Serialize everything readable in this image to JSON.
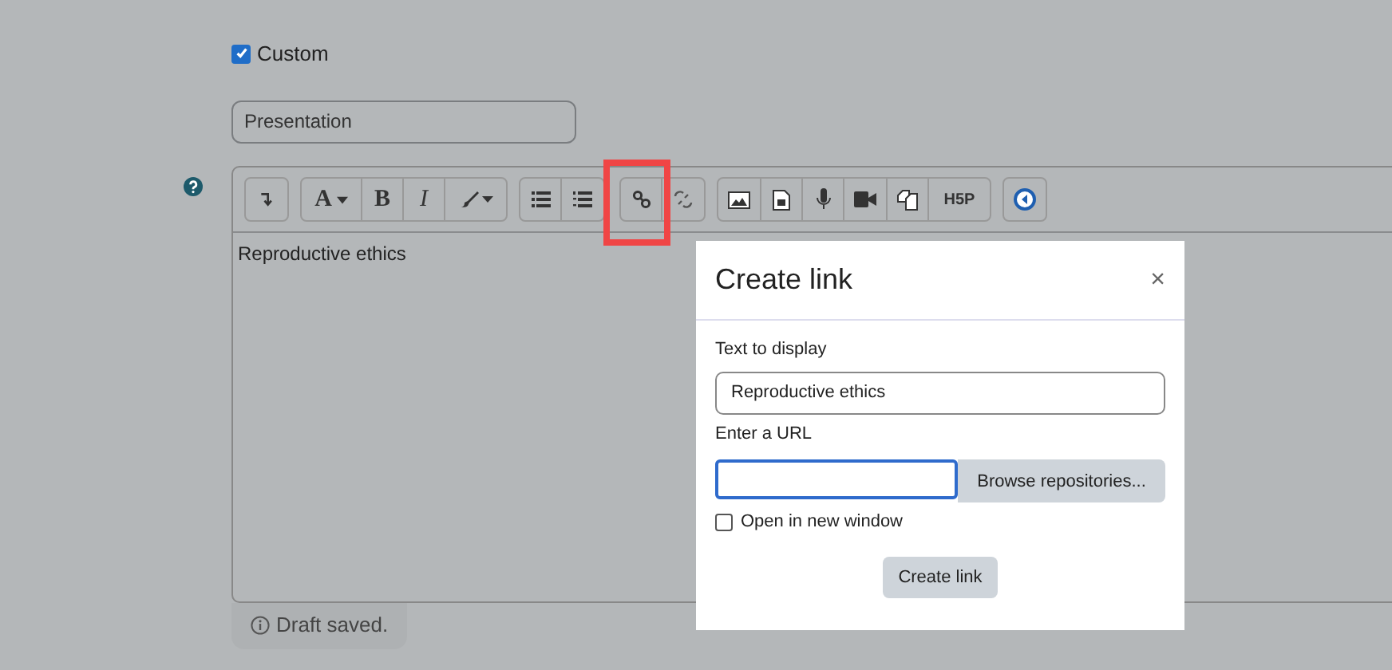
{
  "custom_checkbox": {
    "label": "Custom",
    "checked": true
  },
  "name_field": {
    "value": "Presentation"
  },
  "toolbar": {
    "font_label": "A",
    "bold_label": "B",
    "italic_label": "I",
    "h5p_label": "H5P"
  },
  "editor": {
    "content": "Reproductive ethics"
  },
  "draft_status": "Draft saved.",
  "dialog": {
    "title": "Create link",
    "close": "×",
    "text_label": "Text to display",
    "text_value": "Reproductive ethics",
    "url_label": "Enter a URL",
    "browse_button": "Browse repositories...",
    "new_window": {
      "label": "Open in new window",
      "checked": false
    },
    "submit_button": "Create link"
  }
}
